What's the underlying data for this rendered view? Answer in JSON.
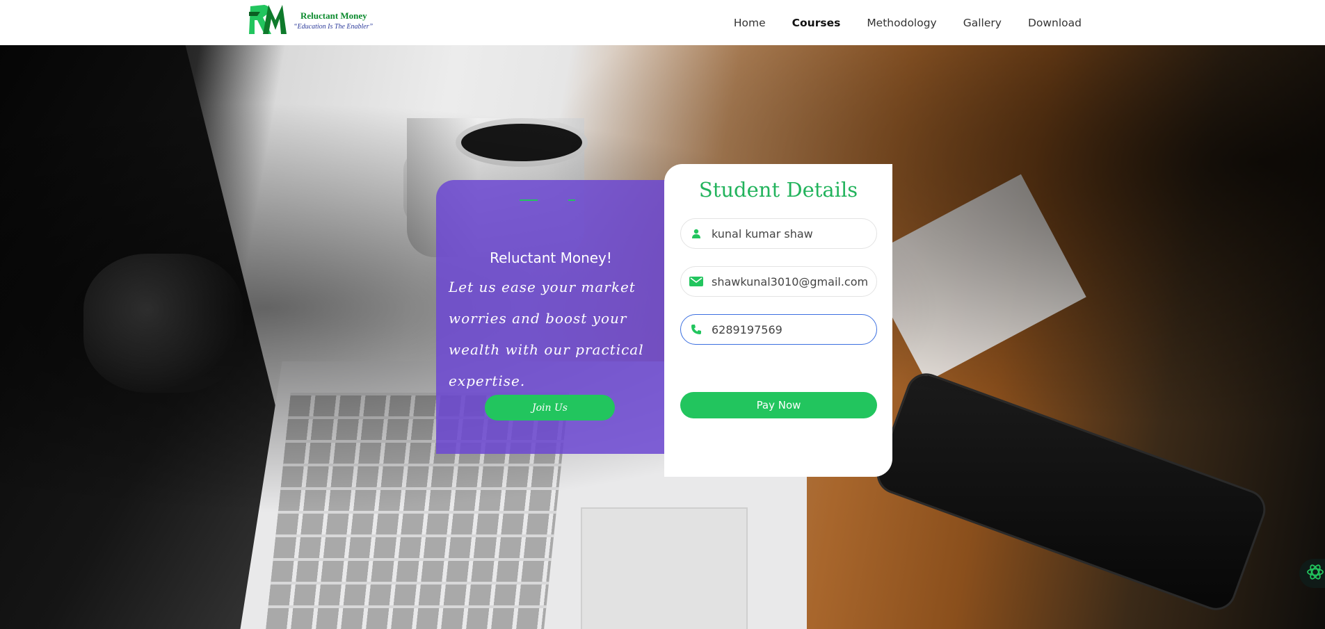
{
  "header": {
    "logo": {
      "name": "Reluctant Money",
      "tagline": "“Education Is The Enabler”",
      "mark": "RM"
    },
    "nav": [
      {
        "label": "Home",
        "active": false
      },
      {
        "label": "Courses",
        "active": true
      },
      {
        "label": "Methodology",
        "active": false
      },
      {
        "label": "Gallery",
        "active": false
      },
      {
        "label": "Download",
        "active": false
      }
    ]
  },
  "promo": {
    "title": "Reluctant Money!",
    "text": "Let us ease your market worries and boost your wealth with our practical expertise.",
    "join_label": "Join Us"
  },
  "form": {
    "title": "Student Details",
    "name_value": "kunal kumar shaw",
    "email_value": "shawkunal3010@gmail.com",
    "phone_value": "6289197569",
    "pay_label": "Pay Now"
  },
  "colors": {
    "accent_green": "#22c55e",
    "promo_purple": "#6c48d2",
    "focus_blue": "#3b6fe0"
  },
  "icons": {
    "name": "person-icon",
    "email": "mail-icon",
    "phone": "phone-icon",
    "fab": "atom-icon"
  }
}
